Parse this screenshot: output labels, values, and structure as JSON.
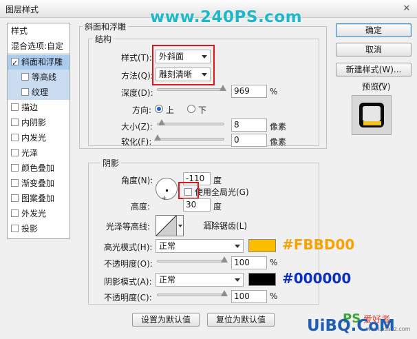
{
  "window": {
    "title": "图层样式",
    "close": "✕"
  },
  "watermark": "www.240PS.com",
  "left_panel": {
    "header": "样式",
    "blend_options": "混合选项:自定",
    "items": [
      {
        "label": "斜面和浮雕",
        "checked": true
      },
      {
        "label": "等高线",
        "checked": false
      },
      {
        "label": "纹理",
        "checked": false
      },
      {
        "label": "描边",
        "checked": false
      },
      {
        "label": "内阴影",
        "checked": false
      },
      {
        "label": "内发光",
        "checked": false
      },
      {
        "label": "光泽",
        "checked": false
      },
      {
        "label": "颜色叠加",
        "checked": false
      },
      {
        "label": "渐变叠加",
        "checked": false
      },
      {
        "label": "图案叠加",
        "checked": false
      },
      {
        "label": "外发光",
        "checked": false
      },
      {
        "label": "投影",
        "checked": false
      }
    ]
  },
  "bevel": {
    "group_title": "斜面和浮雕",
    "structure_title": "结构",
    "style_label": "样式(T):",
    "style_value": "外斜面",
    "technique_label": "方法(Q):",
    "technique_value": "雕刻清晰",
    "depth_label": "深度(D):",
    "depth_value": "969",
    "depth_unit": "%",
    "depth_level": 0.97,
    "direction_label": "方向:",
    "direction_up": "上",
    "direction_down": "下",
    "size_label": "大小(Z):",
    "size_value": "8",
    "size_unit": "像素",
    "soften_label": "软化(F):",
    "soften_value": "0",
    "soften_unit": "像素"
  },
  "shading": {
    "title": "阴影",
    "angle_label": "角度(N):",
    "angle_value": "-110",
    "angle_unit": "度",
    "global_light_label": "使用全局光(G)",
    "altitude_label": "高度:",
    "altitude_value": "30",
    "altitude_unit": "度",
    "gloss_label": "光泽等高线:",
    "antialias_label": "消除锯齿(L)",
    "highlight_mode_label": "高光模式(H):",
    "highlight_mode_value": "正常",
    "highlight_color": "#FBBD00",
    "highlight_annotation": "#FBBD00",
    "highlight_opacity_label": "不透明度(O):",
    "highlight_opacity_value": "100",
    "highlight_opacity_unit": "%",
    "shadow_mode_label": "阴影模式(A):",
    "shadow_mode_value": "正常",
    "shadow_color": "#000000",
    "shadow_annotation": "#000000",
    "shadow_opacity_label": "不透明度(C):",
    "shadow_opacity_value": "100",
    "shadow_opacity_unit": "%"
  },
  "buttons": {
    "ok": "确定",
    "cancel": "取消",
    "new_style": "新建样式(W)...",
    "preview": "预览(V)",
    "set_default": "设置为默认值",
    "reset_default": "复位为默认值"
  },
  "bottom_watermark": {
    "brand": "UiBQ.CoM",
    "ps": "PS",
    "site": "爱好者",
    "url": "www.psahz.com"
  },
  "colors": {
    "accent_red": "#e0141c",
    "highlight_text": "#f7a200",
    "shadow_text": "#0c2fc4",
    "watermark": "#1fb8c8"
  }
}
